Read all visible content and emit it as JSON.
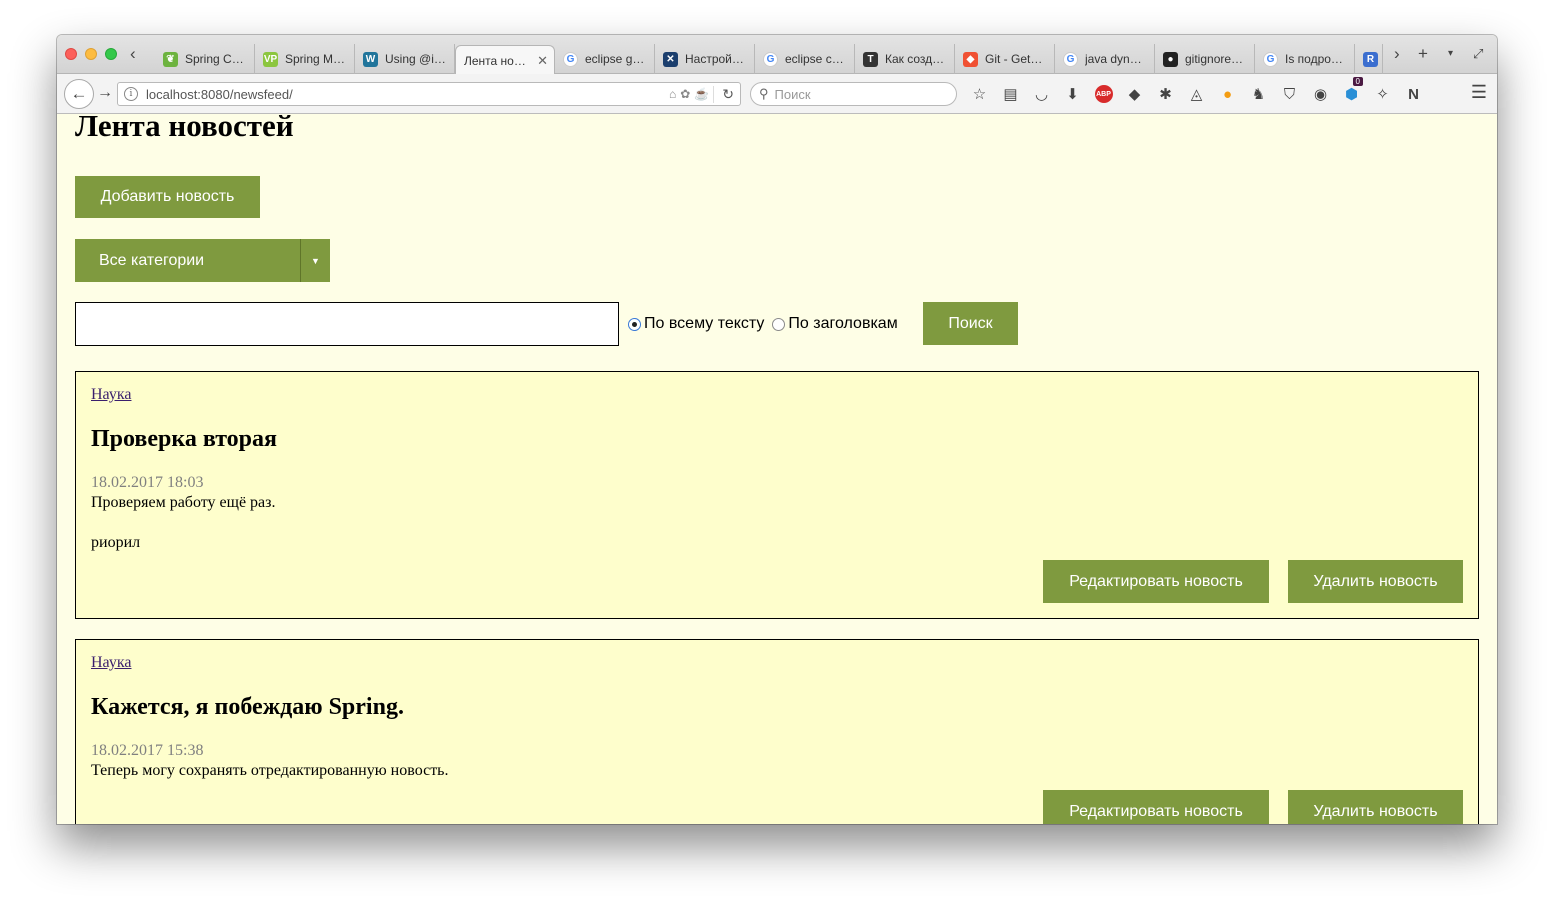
{
  "browser": {
    "tabs": [
      {
        "label": "Spring C…",
        "icon": "spring-leaf-icon",
        "color": "#6db33f",
        "glyph": "❦"
      },
      {
        "label": "Spring M…",
        "icon": "vp-icon",
        "color": "#8cc63f",
        "glyph": "VP"
      },
      {
        "label": "Using @i…",
        "icon": "wordpress-icon",
        "color": "#21759b",
        "glyph": "W"
      },
      {
        "label": "Лента но…",
        "icon": "page-icon",
        "color": "#f7f7f7",
        "glyph": "",
        "active": true
      },
      {
        "label": "eclipse g…",
        "icon": "google-icon",
        "color": "#4285f4",
        "glyph": "G"
      },
      {
        "label": "Настрой…",
        "icon": "xcode-icon",
        "color": "#1c3f6e",
        "glyph": "✕"
      },
      {
        "label": "eclipse c…",
        "icon": "google-icon",
        "color": "#4285f4",
        "glyph": "G"
      },
      {
        "label": "Как созд…",
        "icon": "toster-icon",
        "color": "#333333",
        "glyph": "T"
      },
      {
        "label": "Git - Get…",
        "icon": "git-icon",
        "color": "#f05133",
        "glyph": "◆"
      },
      {
        "label": "java dyn…",
        "icon": "google-icon",
        "color": "#4285f4",
        "glyph": "G"
      },
      {
        "label": "gitignore…",
        "icon": "github-icon",
        "color": "#222222",
        "glyph": "●"
      },
      {
        "label": "Is подро…",
        "icon": "google-icon",
        "color": "#4285f4",
        "glyph": "G"
      },
      {
        "label": "",
        "icon": "r-icon",
        "color": "#3b6ecf",
        "glyph": "R"
      }
    ],
    "url": "localhost:8080/newsfeed/",
    "search_placeholder": "Поиск",
    "ext_badge": "0"
  },
  "page": {
    "title": "Лента новостей",
    "add_button": "Добавить новость",
    "category_select": "Все категории",
    "search": {
      "value": "",
      "radio_full_text": "По всему тексту",
      "radio_titles": "По заголовкам",
      "button": "Поиск"
    },
    "news": [
      {
        "category": "Наука",
        "title": "Проверка вторая",
        "date": "18.02.2017 18:03",
        "body": [
          "Проверяем работу ещё раз.",
          "риорил"
        ],
        "edit_button": "Редактировать новость",
        "delete_button": "Удалить новость"
      },
      {
        "category": "Наука",
        "title": "Кажется, я побеждаю Spring.",
        "date": "18.02.2017 15:38",
        "body": [
          "Теперь могу сохранять отредактированную новость."
        ],
        "edit_button": "Редактировать новость",
        "delete_button": "Удалить новость"
      }
    ]
  },
  "colors": {
    "accent": "#7f9a3f",
    "page_bg": "#fefee6",
    "card_bg": "#fefecc",
    "link": "#3a1f6d",
    "date": "#808080"
  }
}
